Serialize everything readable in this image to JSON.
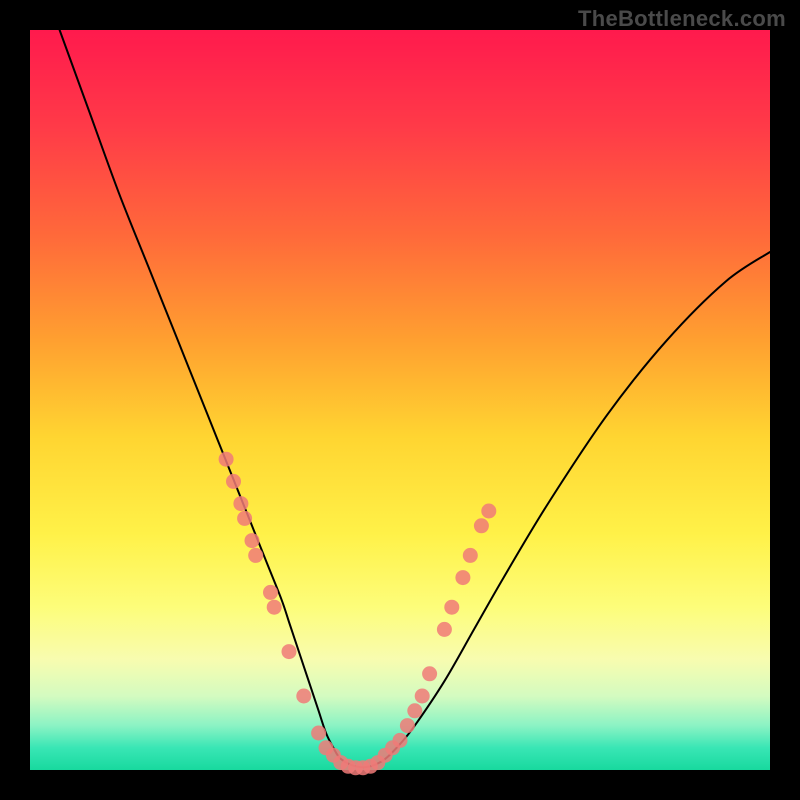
{
  "watermark": "TheBottleneck.com",
  "chart_data": {
    "type": "line",
    "title": "",
    "xlabel": "",
    "ylabel": "",
    "xlim": [
      0,
      100
    ],
    "ylim": [
      0,
      100
    ],
    "curve": {
      "x": [
        4,
        8,
        12,
        16,
        20,
        24,
        26,
        28,
        30,
        32,
        34,
        35,
        36,
        37,
        38,
        39,
        40,
        41,
        42,
        44,
        46,
        48,
        50,
        52,
        56,
        60,
        64,
        70,
        78,
        86,
        94,
        100
      ],
      "y": [
        100,
        89,
        78,
        68,
        58,
        48,
        43,
        38,
        33,
        28,
        23,
        20,
        17,
        14,
        11,
        8,
        5,
        3,
        1.5,
        0.5,
        0.5,
        1.5,
        3.5,
        6,
        12,
        19,
        26,
        36,
        48,
        58,
        66,
        70
      ]
    },
    "markers": [
      {
        "x": 26.5,
        "y": 42
      },
      {
        "x": 27.5,
        "y": 39
      },
      {
        "x": 28.5,
        "y": 36
      },
      {
        "x": 29.0,
        "y": 34
      },
      {
        "x": 30.0,
        "y": 31
      },
      {
        "x": 30.5,
        "y": 29
      },
      {
        "x": 32.5,
        "y": 24
      },
      {
        "x": 33.0,
        "y": 22
      },
      {
        "x": 35.0,
        "y": 16
      },
      {
        "x": 37.0,
        "y": 10
      },
      {
        "x": 39.0,
        "y": 5
      },
      {
        "x": 40.0,
        "y": 3
      },
      {
        "x": 41.0,
        "y": 2
      },
      {
        "x": 42.0,
        "y": 1
      },
      {
        "x": 43.0,
        "y": 0.5
      },
      {
        "x": 44.0,
        "y": 0.3
      },
      {
        "x": 45.0,
        "y": 0.3
      },
      {
        "x": 46.0,
        "y": 0.5
      },
      {
        "x": 47.0,
        "y": 1
      },
      {
        "x": 48.0,
        "y": 2
      },
      {
        "x": 49.0,
        "y": 3
      },
      {
        "x": 50.0,
        "y": 4
      },
      {
        "x": 51.0,
        "y": 6
      },
      {
        "x": 52.0,
        "y": 8
      },
      {
        "x": 53.0,
        "y": 10
      },
      {
        "x": 54.0,
        "y": 13
      },
      {
        "x": 56.0,
        "y": 19
      },
      {
        "x": 57.0,
        "y": 22
      },
      {
        "x": 58.5,
        "y": 26
      },
      {
        "x": 59.5,
        "y": 29
      },
      {
        "x": 61.0,
        "y": 33
      },
      {
        "x": 62.0,
        "y": 35
      }
    ],
    "marker_color": "#f07a78",
    "curve_color": "#000000"
  }
}
